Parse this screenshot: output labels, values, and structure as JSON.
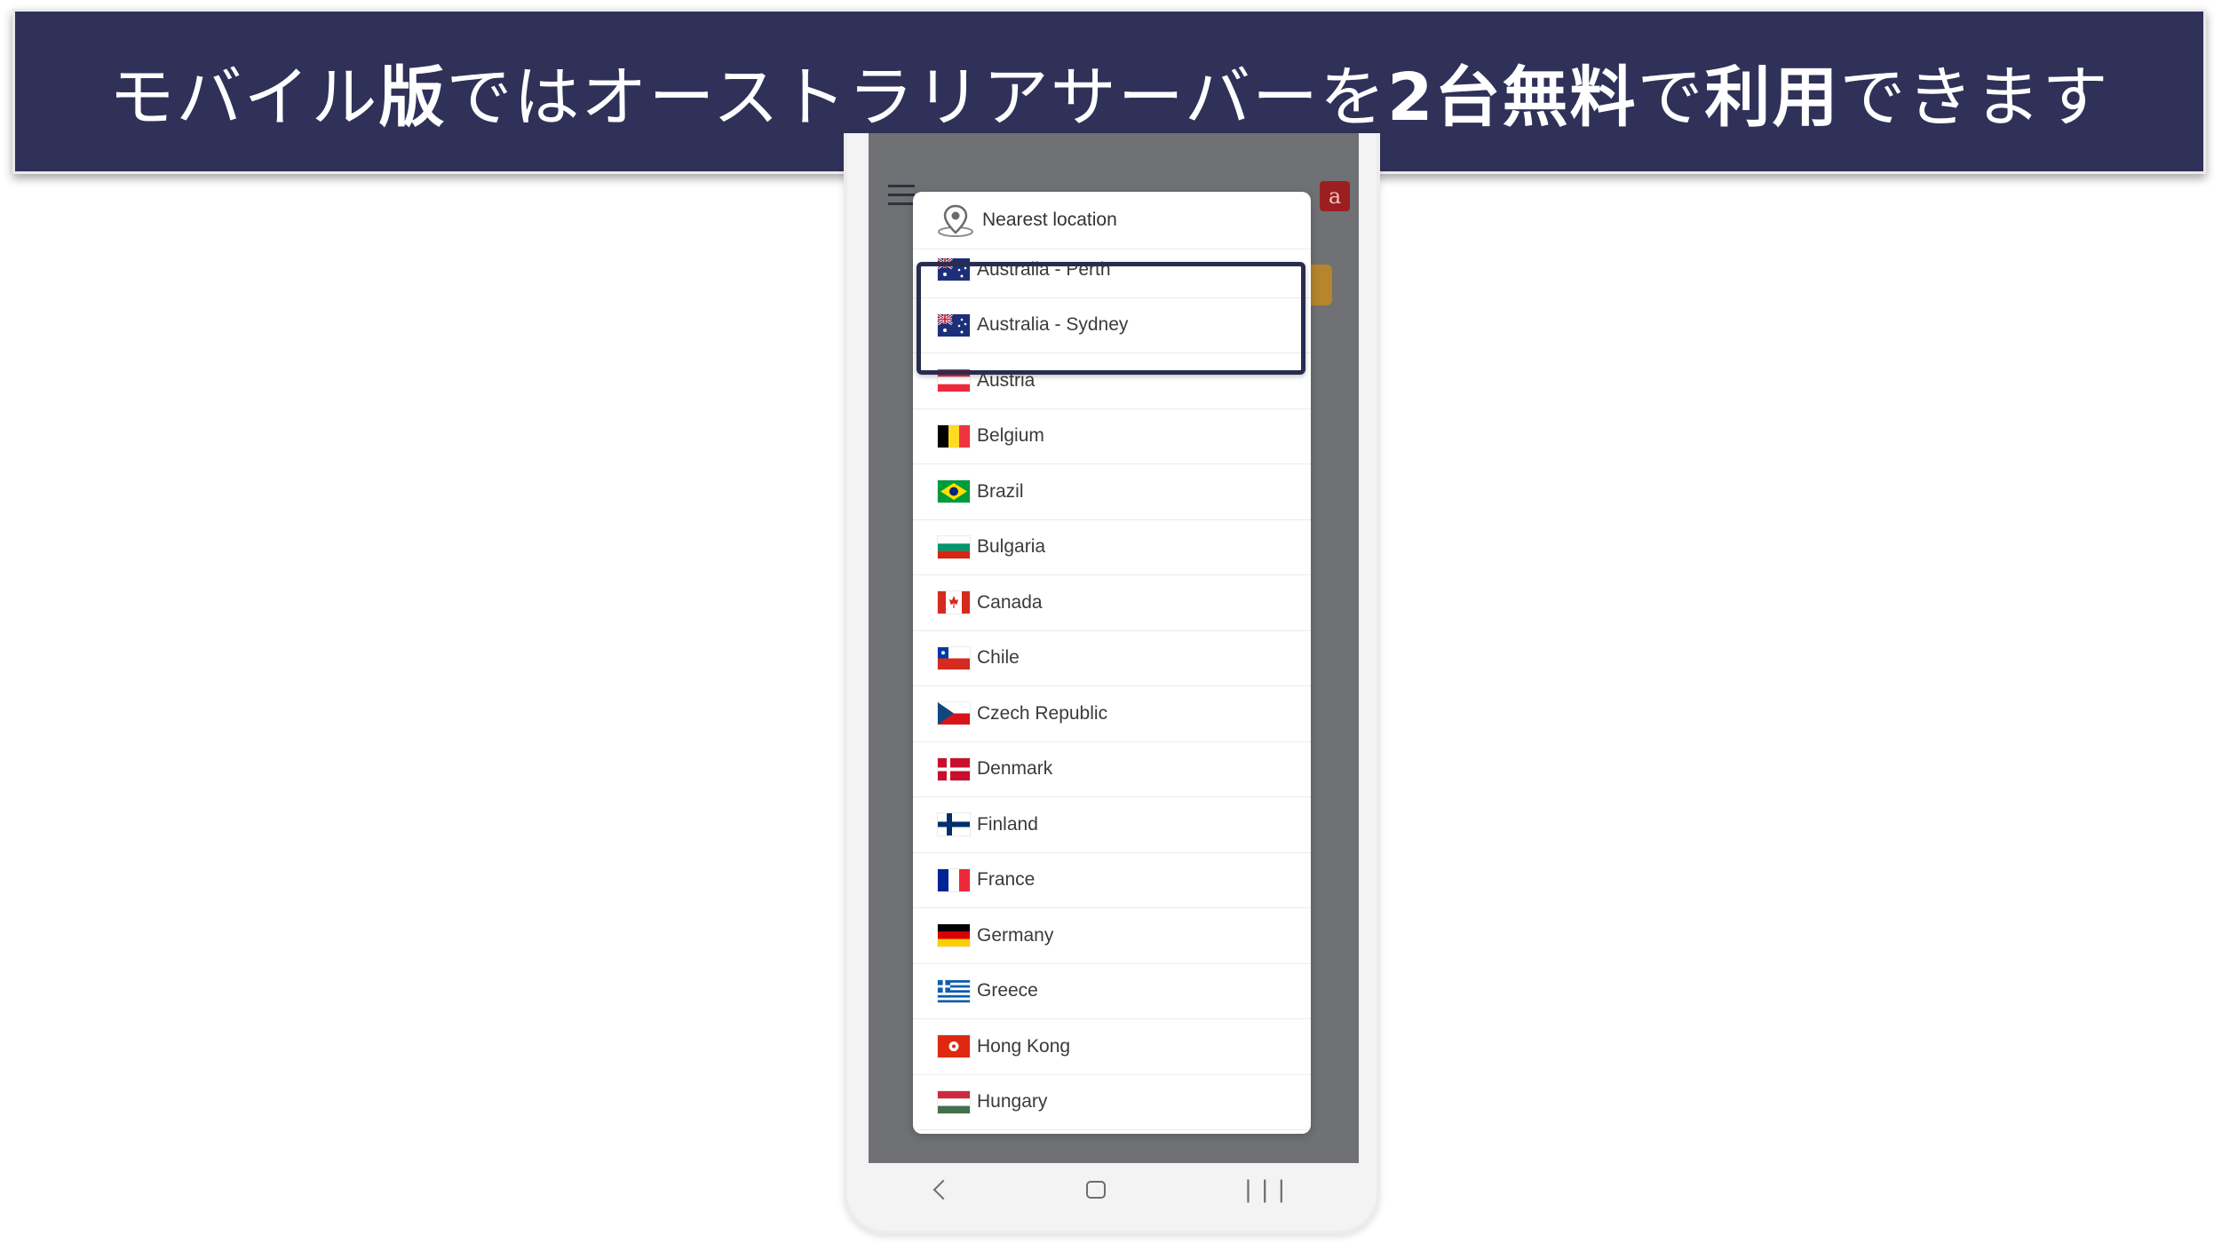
{
  "banner": {
    "text_before": "モバイル",
    "bold_1": "版",
    "text_middle": "ではオーストラリアサーバーを",
    "bold_2": "2台無料",
    "text_middle_2": "で",
    "bold_3": "利用",
    "text_after": "できます"
  },
  "dropdown": {
    "header_label": "Nearest location",
    "countries": [
      {
        "name": "Australia - Perth",
        "flag": "au"
      },
      {
        "name": "Australia - Sydney",
        "flag": "au"
      },
      {
        "name": "Austria",
        "flag": "at"
      },
      {
        "name": "Belgium",
        "flag": "be"
      },
      {
        "name": "Brazil",
        "flag": "br"
      },
      {
        "name": "Bulgaria",
        "flag": "bg"
      },
      {
        "name": "Canada",
        "flag": "ca"
      },
      {
        "name": "Chile",
        "flag": "cl"
      },
      {
        "name": "Czech Republic",
        "flag": "cz"
      },
      {
        "name": "Denmark",
        "flag": "dk"
      },
      {
        "name": "Finland",
        "flag": "fi"
      },
      {
        "name": "France",
        "flag": "fr"
      },
      {
        "name": "Germany",
        "flag": "de"
      },
      {
        "name": "Greece",
        "flag": "gr"
      },
      {
        "name": "Hong Kong",
        "flag": "hk"
      },
      {
        "name": "Hungary",
        "flag": "hu"
      }
    ]
  },
  "colors": {
    "banner_bg": "#2f3159",
    "highlight_border": "#2a2c4f",
    "overlay": "#6f7174"
  }
}
